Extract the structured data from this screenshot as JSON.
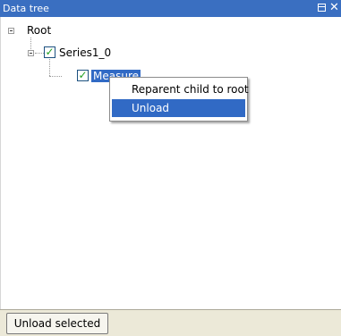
{
  "window": {
    "title": "Data tree",
    "controls": {
      "restore_icon": "restore-icon",
      "close_glyph": "✕"
    }
  },
  "tree": {
    "root": {
      "label": "Root",
      "expanded": true,
      "children": [
        {
          "label": "Series1_0",
          "checked": true,
          "expanded": true,
          "children": [
            {
              "label": "Measure",
              "checked": true,
              "selected": true
            }
          ]
        }
      ]
    },
    "check_glyph": "✓"
  },
  "context_menu": {
    "items": [
      {
        "label": "Reparent child to root",
        "highlighted": false
      },
      {
        "label": "Unload",
        "highlighted": true
      }
    ]
  },
  "bottom_bar": {
    "unload_selected_label": "Unload selected"
  },
  "colors": {
    "title_bar": "#3a6fc1",
    "selection": "#316ac5",
    "check": "#21a121",
    "toolbar_bg": "#ece9d8"
  }
}
